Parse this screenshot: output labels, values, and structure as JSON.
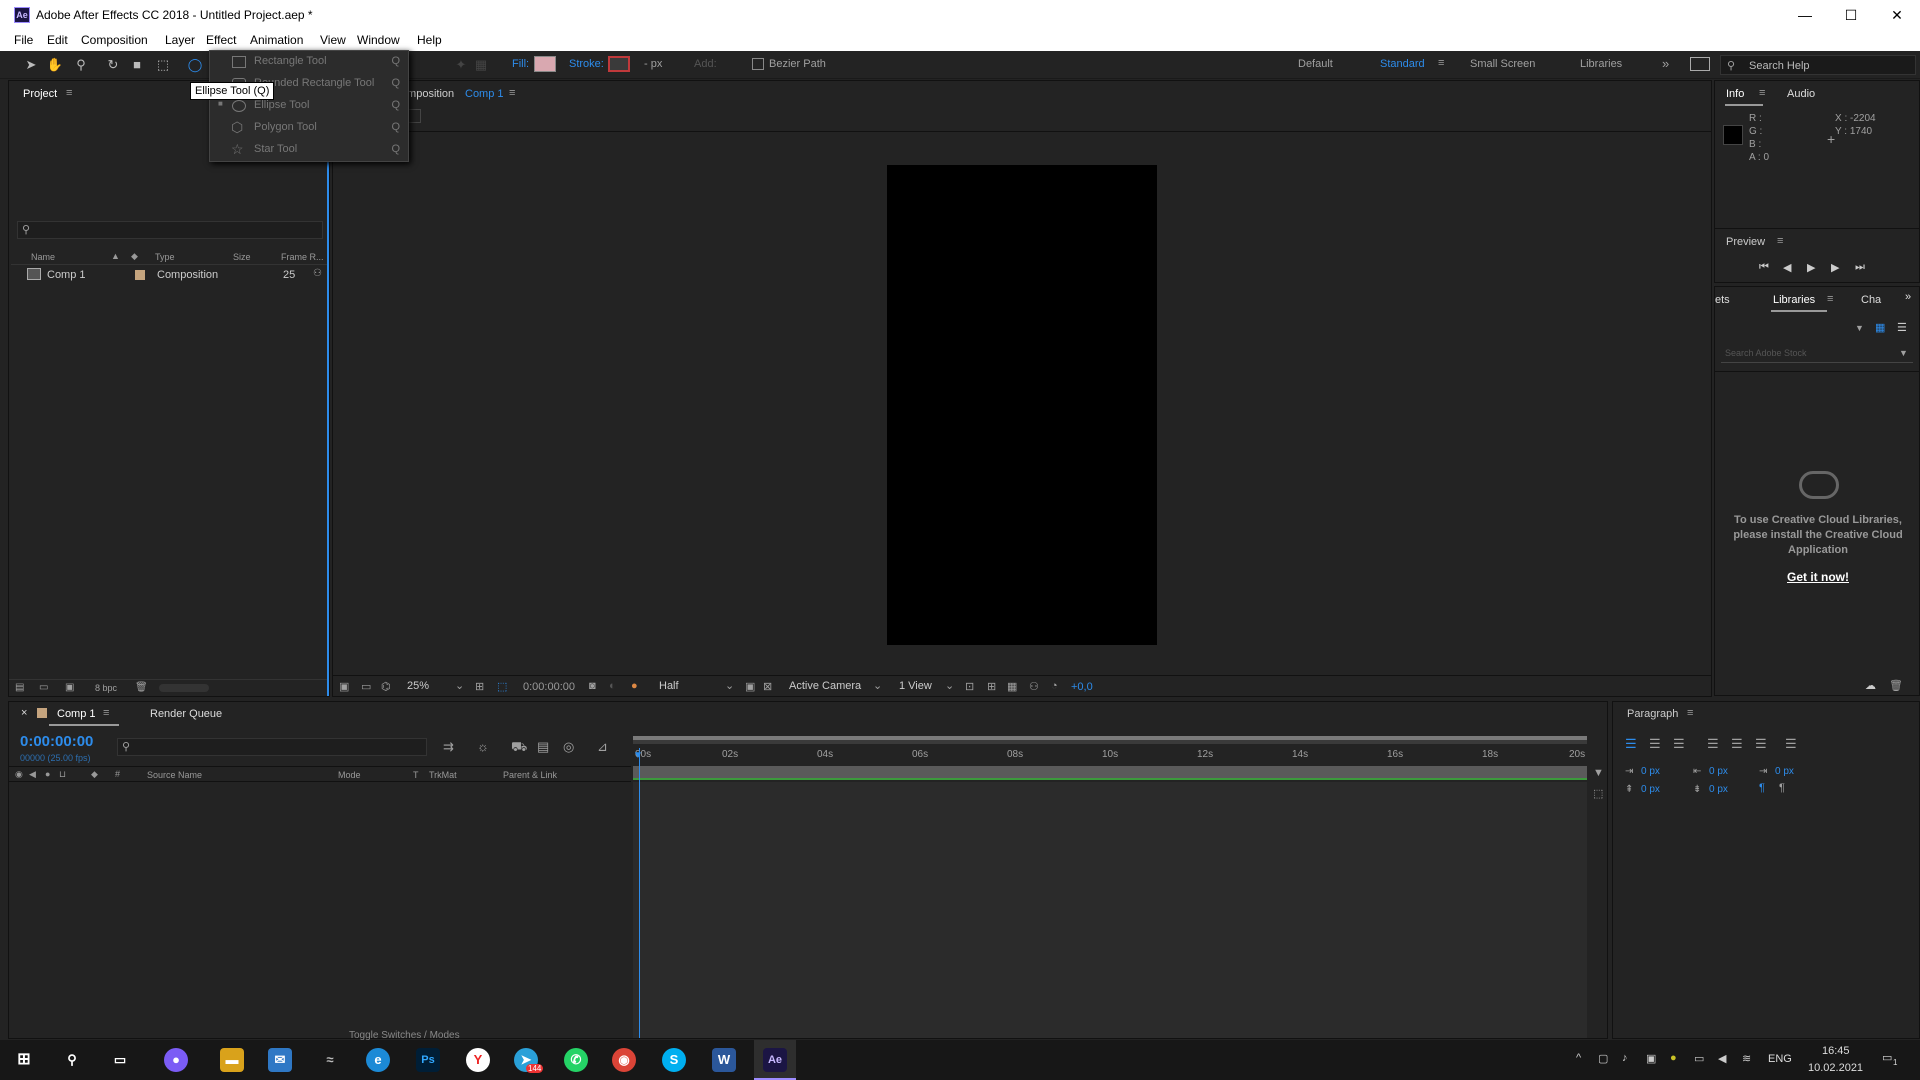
{
  "window": {
    "title": "Adobe After Effects CC 2018 - Untitled Project.aep *",
    "app_icon": "Ae",
    "controls": [
      "—",
      "☐",
      "✕"
    ]
  },
  "menu": [
    "File",
    "Edit",
    "Composition",
    "Layer",
    "Effect",
    "Animation",
    "View",
    "Window",
    "Help"
  ],
  "toolbar": {
    "fill_label": "Fill:",
    "stroke_label": "Stroke:",
    "stroke_px": "- px",
    "add_label": "Add:",
    "bezier_label": "Bezier Path",
    "workspaces": [
      "Default",
      "Standard",
      "Small Screen",
      "Libraries"
    ],
    "active_workspace": "Standard",
    "search_placeholder": "Search Help"
  },
  "shape_menu": {
    "items": [
      {
        "label": "Rectangle Tool",
        "key": "Q"
      },
      {
        "label": "Rounded Rectangle Tool",
        "key": "Q"
      },
      {
        "label": "Ellipse Tool",
        "key": "Q"
      },
      {
        "label": "Polygon Tool",
        "key": "Q"
      },
      {
        "label": "Star Tool",
        "key": "Q"
      }
    ],
    "tooltip": "Ellipse Tool (Q)"
  },
  "project": {
    "title": "Project",
    "columns": [
      "Name",
      "Type",
      "Size",
      "Frame R..."
    ],
    "rows": [
      {
        "name": "Comp 1",
        "type": "Composition",
        "fps": "25"
      }
    ],
    "bpc": "8 bpc"
  },
  "composition": {
    "tab_prefix": "Composition",
    "tab_name": "Comp 1",
    "footer": {
      "zoom": "25%",
      "time": "0:00:00:00",
      "resolution": "Half",
      "camera": "Active Camera",
      "views": "1 View",
      "exposure": "+0,0"
    }
  },
  "info": {
    "tabs": [
      "Info",
      "Audio"
    ],
    "r": "R :",
    "g": "G :",
    "b": "B :",
    "a": "A : 0",
    "x": "X : -2204",
    "y": "Y : 1740"
  },
  "preview": {
    "title": "Preview"
  },
  "libraries": {
    "tabs": [
      "ets",
      "Libraries",
      "Cha"
    ],
    "search_placeholder": "Search Adobe Stock",
    "message": "To use Creative Cloud Libraries, please install the Creative Cloud Application",
    "link": "Get it now!"
  },
  "timeline": {
    "tab": "Comp 1",
    "render_queue": "Render Queue",
    "timecode": "0:00:00:00",
    "fps": "00000 (25.00 fps)",
    "columns": [
      "Source Name",
      "Mode",
      "T",
      "TrkMat",
      "Parent & Link"
    ],
    "ruler": [
      "00s",
      "02s",
      "04s",
      "06s",
      "08s",
      "10s",
      "12s",
      "14s",
      "16s",
      "18s",
      "20s"
    ],
    "footer": "Toggle Switches / Modes"
  },
  "paragraph": {
    "title": "Paragraph",
    "fields": [
      "0 px",
      "0 px",
      "0 px",
      "0 px",
      "0 px"
    ]
  },
  "taskbar": {
    "lang": "ENG",
    "time": "16:45",
    "date": "10.02.2021",
    "badge": "144",
    "notif": "1"
  },
  "colors": {
    "accent": "#2d8ceb",
    "fill_swatch": "#d9a8b0",
    "stroke_swatch": "#c0393b"
  }
}
